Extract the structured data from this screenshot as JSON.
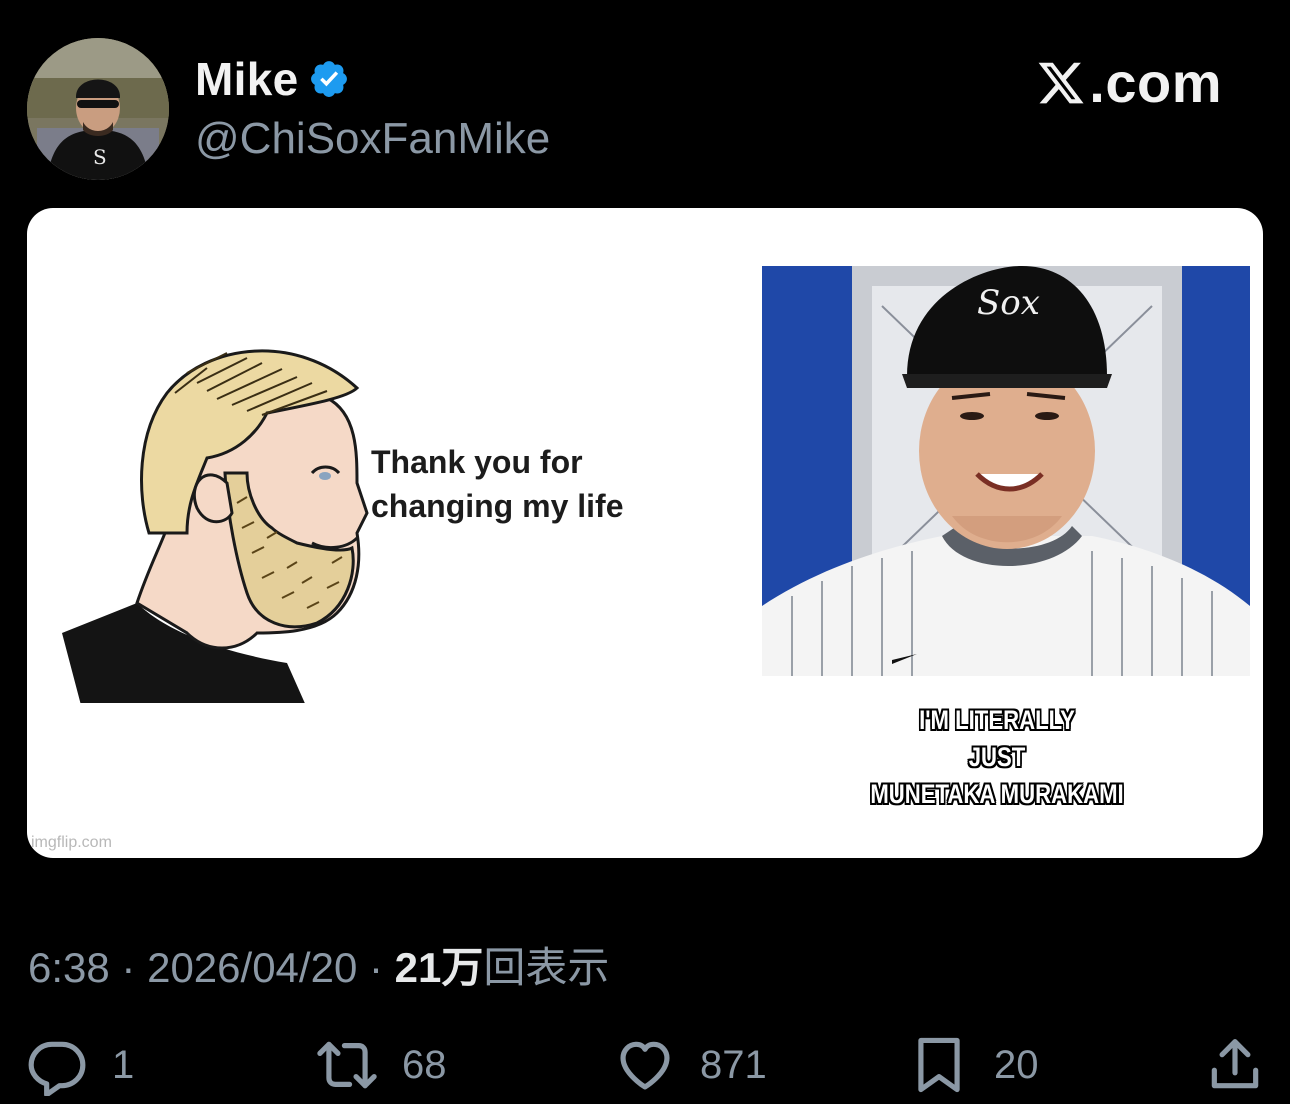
{
  "author": {
    "display_name": "Mike",
    "handle": "@ChiSoxFanMike",
    "verified": true,
    "verified_color": "#1d9bf0"
  },
  "brand": {
    "text": ".com"
  },
  "media": {
    "meme_text": [
      "Thank you for",
      "changing my life"
    ],
    "caption": [
      "I'M LITERALLY",
      "JUST",
      "MUNETAKA MURAKAMI"
    ],
    "watermark": "imgflip.com"
  },
  "meta": {
    "time": "6:38",
    "sep1": "·",
    "date": "2026/04/20",
    "sep2": "·",
    "views_number": "21万",
    "views_label": "回表示"
  },
  "actions": {
    "reply_count": "1",
    "retweet_count": "68",
    "like_count": "871",
    "bookmark_count": "20"
  },
  "icons": [
    "verified-badge-icon",
    "x-logo-icon",
    "reply-icon",
    "retweet-icon",
    "like-icon",
    "bookmark-icon",
    "share-icon"
  ]
}
